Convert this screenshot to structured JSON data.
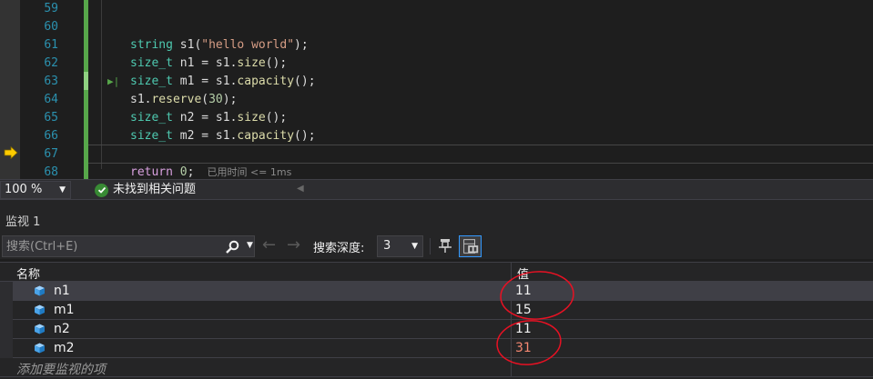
{
  "editor": {
    "line_numbers": [
      "59",
      "60",
      "61",
      "62",
      "63",
      "64",
      "65",
      "66",
      "67",
      "68"
    ],
    "lines": {
      "l60": {
        "kw1": "string",
        "mid": " s1(",
        "str": "\"hello world\"",
        "end": ");"
      },
      "l61": {
        "kw1": "size_t",
        "mid": " n1 = s1.",
        "fn": "size",
        "end": "();"
      },
      "l62": {
        "kw1": "size_t",
        "mid": " m1 = s1.",
        "fn": "capacity",
        "end": "();"
      },
      "l63": {
        "pre": "s1.",
        "fn": "reserve",
        "open": "(",
        "num": "30",
        "end": ");"
      },
      "l64": {
        "kw1": "size_t",
        "mid": " n2 = s1.",
        "fn": "size",
        "end": "();"
      },
      "l65": {
        "kw1": "size_t",
        "mid": " m2 = s1.",
        "fn": "capacity",
        "end": "();"
      },
      "l67": {
        "kw": "return",
        "sp": " ",
        "num": "0",
        "end": ";",
        "perf": "已用时间 <= 1ms"
      },
      "l68": {
        "text": "}"
      }
    },
    "run_to_cursor_glyph": "▶|"
  },
  "status": {
    "zoom": "100 %",
    "issues": "未找到相关问题"
  },
  "watch": {
    "title": "监视 1",
    "search_placeholder": "搜索(Ctrl+E)",
    "depth_label": "搜索深度:",
    "depth_value": "3",
    "columns": {
      "name": "名称",
      "value": "值"
    },
    "rows": [
      {
        "name": "n1",
        "value": "11"
      },
      {
        "name": "m1",
        "value": "15"
      },
      {
        "name": "n2",
        "value": "11"
      },
      {
        "name": "m2",
        "value": "31"
      }
    ],
    "add_label": "添加要监视的项"
  },
  "colors": {
    "accent": "#3399ff",
    "changed_value": "#f48771",
    "annotation_circle": "#e81123",
    "change_bar": "#57a64a"
  }
}
